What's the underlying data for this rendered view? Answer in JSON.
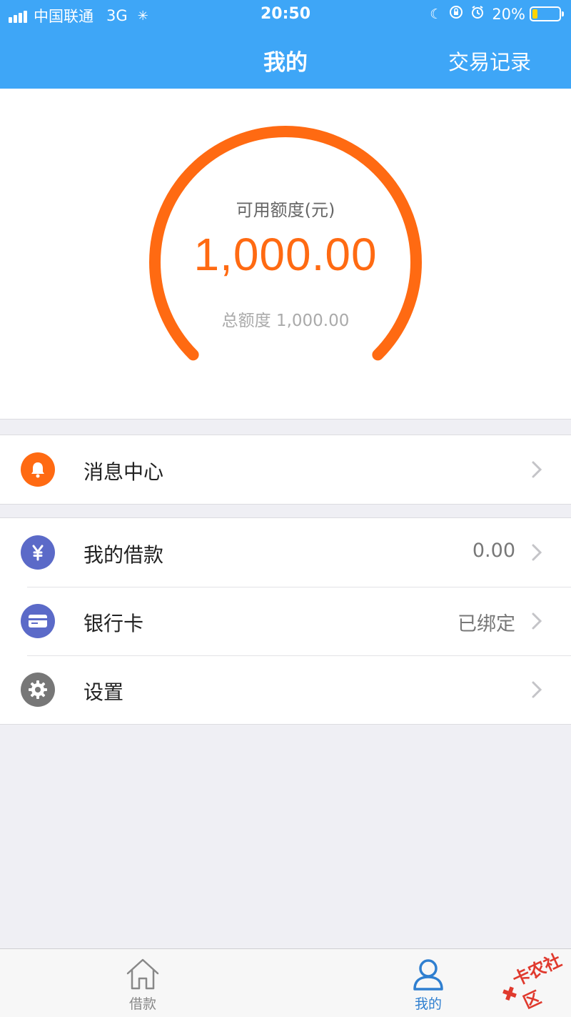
{
  "status_bar": {
    "carrier": "中国联通",
    "network": "3G",
    "time": "20:50",
    "battery_text": "20%",
    "battery_level": 0.2
  },
  "nav": {
    "title": "我的",
    "right_action": "交易记录"
  },
  "credit": {
    "label": "可用额度(元)",
    "available": "1,000.00",
    "total_text": "总额度 1,000.00",
    "gauge_fill_fraction": 1.0
  },
  "menu": {
    "messages": {
      "label": "消息中心",
      "icon": "bell-icon"
    },
    "loans": {
      "label": "我的借款",
      "value": "0.00",
      "icon": "yuan-icon"
    },
    "bank_card": {
      "label": "银行卡",
      "value": "已绑定",
      "icon": "card-icon"
    },
    "settings": {
      "label": "设置",
      "icon": "gear-icon"
    }
  },
  "tabbar": {
    "loan": {
      "label": "借款",
      "icon": "home-icon"
    },
    "mine": {
      "label": "我的",
      "icon": "user-icon"
    }
  },
  "watermark": {
    "text": "卡农社区"
  },
  "colors": {
    "header": "#3ea6f7",
    "accent_orange": "#ff6a12",
    "purple": "#5b6ac8",
    "grey_icon": "#777777",
    "tab_active": "#2f7fd0"
  }
}
